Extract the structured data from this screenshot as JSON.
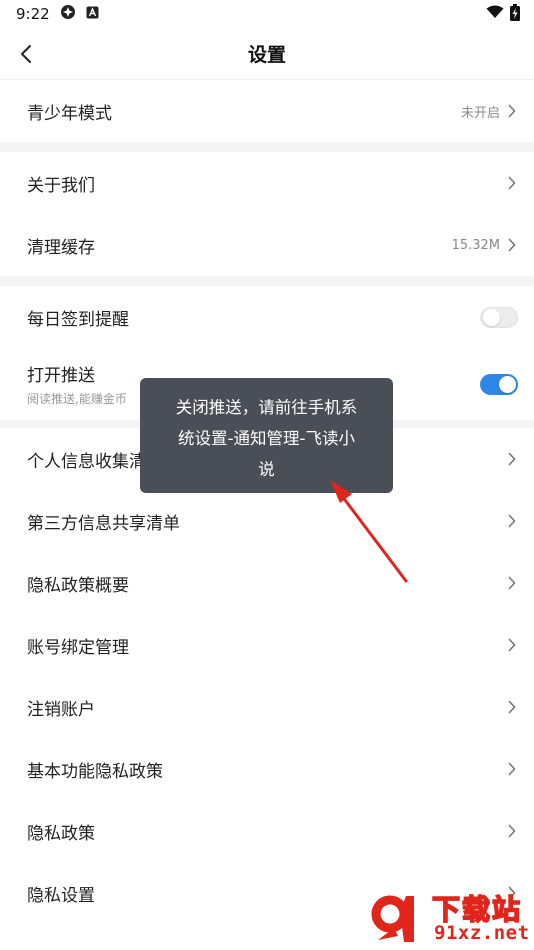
{
  "status_bar": {
    "time": "9:22"
  },
  "header": {
    "title": "设置"
  },
  "groups": [
    [
      {
        "label": "青少年模式",
        "value": "未开启",
        "kind": "arrow"
      }
    ],
    [
      {
        "label": "关于我们",
        "value": "",
        "kind": "arrow"
      },
      {
        "label": "清理缓存",
        "value": "15.32M",
        "kind": "arrow"
      }
    ],
    [
      {
        "label": "每日签到提醒",
        "kind": "toggle",
        "on": false
      },
      {
        "label": "打开推送",
        "sub": "阅读推送,能赚金币",
        "kind": "toggle",
        "on": true
      }
    ],
    [
      {
        "label": "个人信息收集清单",
        "kind": "arrow"
      },
      {
        "label": "第三方信息共享清单",
        "kind": "arrow"
      },
      {
        "label": "隐私政策概要",
        "kind": "arrow"
      },
      {
        "label": "账号绑定管理",
        "kind": "arrow"
      },
      {
        "label": "注销账户",
        "kind": "arrow"
      },
      {
        "label": "基本功能隐私政策",
        "kind": "arrow"
      },
      {
        "label": "隐私政策",
        "kind": "arrow"
      },
      {
        "label": "隐私设置",
        "kind": "arrow"
      }
    ]
  ],
  "toast": {
    "line1": "关闭推送，请前往手机系",
    "line2": "统设置-通知管理-飞读小",
    "line3": "说"
  },
  "watermark": {
    "title": "下载站",
    "url": "91xz.net"
  },
  "colors": {
    "toggle_on": "#2e86e6",
    "toast_bg": "#4a4e56",
    "arrow": "#e0251b"
  }
}
